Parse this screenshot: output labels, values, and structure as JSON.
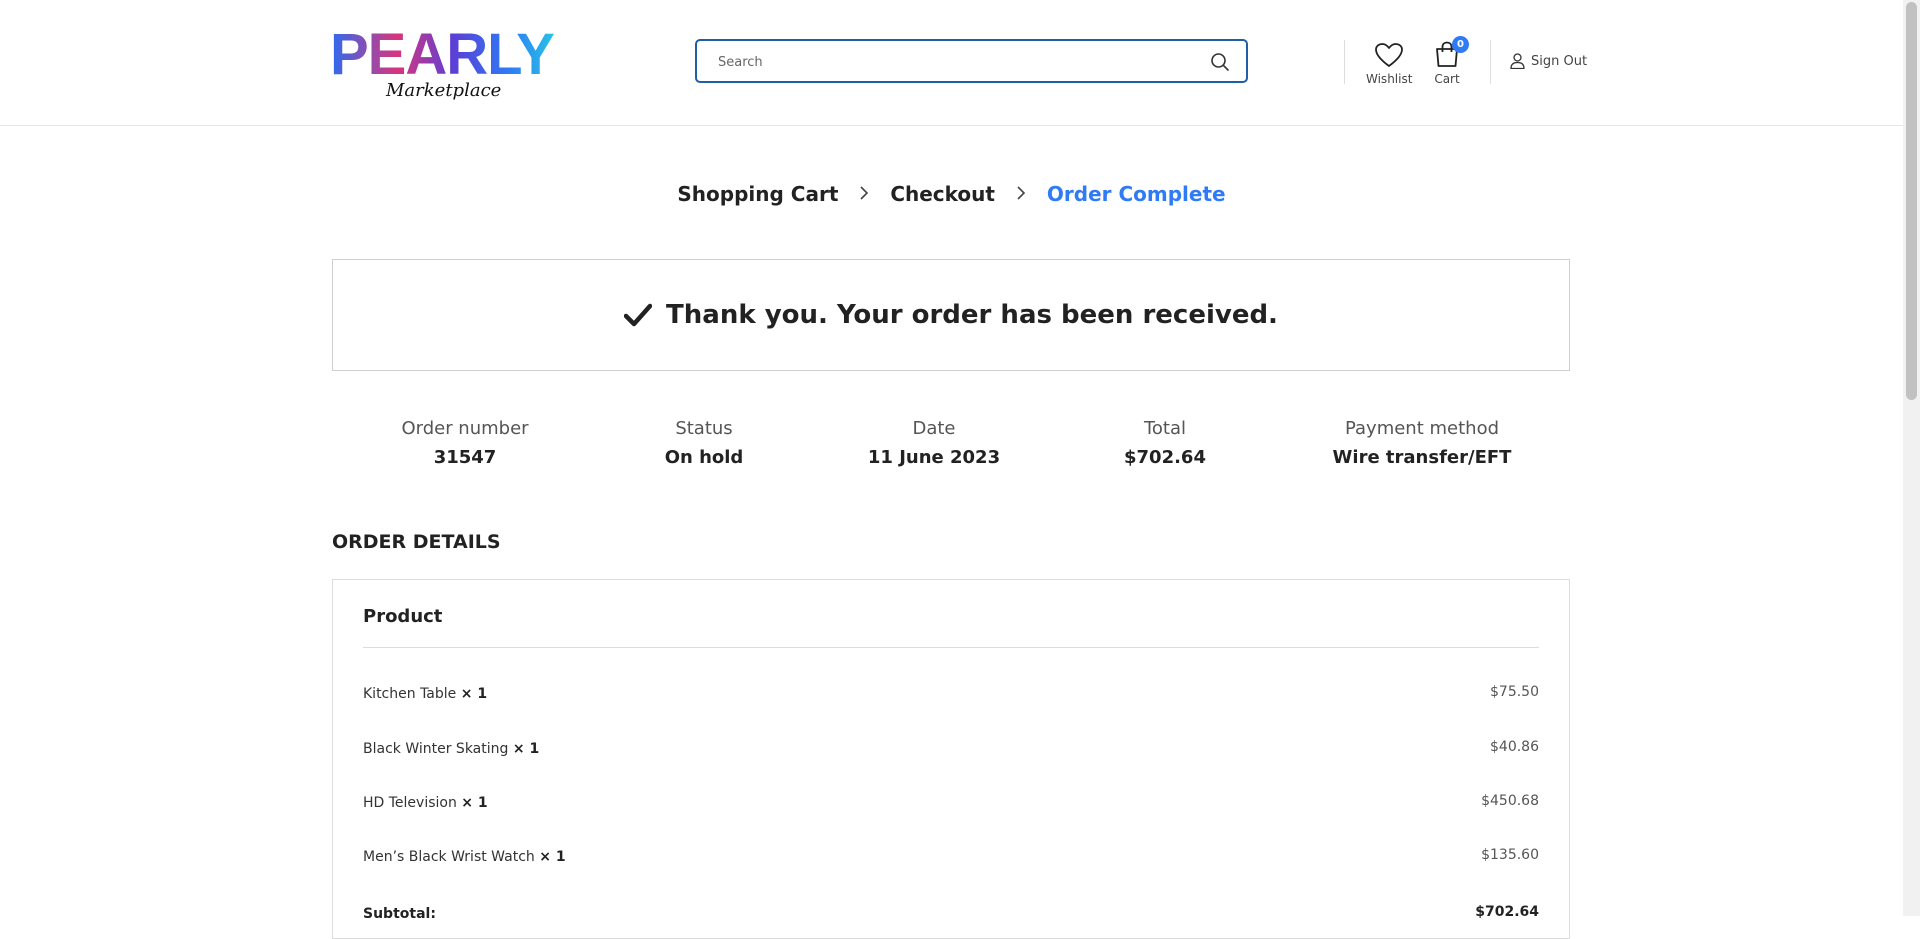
{
  "header": {
    "logo_main": "PEARLY",
    "logo_sub": "Marketplace",
    "search_placeholder": "Search",
    "wishlist_label": "Wishlist",
    "cart_label": "Cart",
    "cart_count": "0",
    "signout_label": "Sign Out",
    "accent_color": "#2f7bf5"
  },
  "breadcrumb": {
    "steps": [
      "Shopping Cart",
      "Checkout",
      "Order Complete"
    ],
    "active_index": 2
  },
  "notice": {
    "message": "Thank you. Your order has been received."
  },
  "overview": [
    {
      "label": "Order number",
      "value": "31547"
    },
    {
      "label": "Status",
      "value": "On hold"
    },
    {
      "label": "Date",
      "value": "11 June 2023"
    },
    {
      "label": "Total",
      "value": "$702.64"
    },
    {
      "label": "Payment method",
      "value": "Wire transfer/EFT"
    }
  ],
  "order_details": {
    "title": "ORDER DETAILS",
    "column_header": "Product",
    "items": [
      {
        "name": "Kitchen Table",
        "qty": "× 1",
        "price": "$75.50"
      },
      {
        "name": "Black Winter Skating",
        "qty": "× 1",
        "price": "$40.86"
      },
      {
        "name": "HD Television",
        "qty": "× 1",
        "price": "$450.68"
      },
      {
        "name": "Men’s Black Wrist Watch",
        "qty": "× 1",
        "price": "$135.60"
      }
    ],
    "subtotal_label": "Subtotal:",
    "subtotal_value": "$702.64"
  },
  "icons": [
    "search-icon",
    "heart-icon",
    "cart-icon",
    "user-icon",
    "chevron-right-icon",
    "checkmark-icon"
  ]
}
